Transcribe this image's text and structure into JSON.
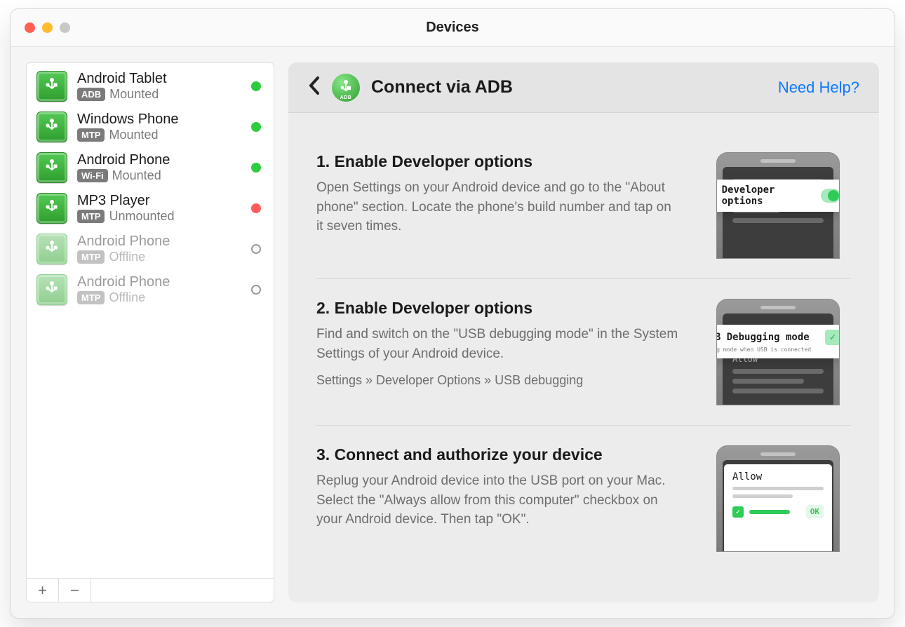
{
  "window": {
    "title": "Devices"
  },
  "sidebar": {
    "devices": [
      {
        "name": "Android Tablet",
        "protocol": "ADB",
        "status": "Mounted",
        "dot": "online",
        "faded": false
      },
      {
        "name": "Windows Phone",
        "protocol": "MTP",
        "status": "Mounted",
        "dot": "online",
        "faded": false
      },
      {
        "name": "Android Phone",
        "protocol": "Wi-Fi",
        "status": "Mounted",
        "dot": "online",
        "faded": false
      },
      {
        "name": "MP3 Player",
        "protocol": "MTP",
        "status": "Unmounted",
        "dot": "offline",
        "faded": false
      },
      {
        "name": "Android Phone",
        "protocol": "MTP",
        "status": "Offline",
        "dot": "hollow",
        "faded": true
      },
      {
        "name": "Android Phone",
        "protocol": "MTP",
        "status": "Offline",
        "dot": "hollow",
        "faded": true
      }
    ],
    "add_label": "+",
    "remove_label": "−"
  },
  "main": {
    "header": {
      "title": "Connect via ADB",
      "help": "Need Help?",
      "adb_label": "ADB"
    },
    "steps": [
      {
        "title": "1. Enable Developer options",
        "body": "Open Settings on your Android device and go to the \"About phone\" section. Locate the phone's build number and tap on it seven times.",
        "path": "",
        "mock": {
          "type": "dev-options",
          "label": "Developer options"
        }
      },
      {
        "title": "2. Enable Developer options",
        "body": "Find and switch on the \"USB debugging mode\" in the System Settings of your Android device.",
        "path": "Settings » Developer Options » USB debugging",
        "mock": {
          "type": "usb-debug",
          "label": "USB Debugging mode",
          "sub": "Debug mode when USB is connected",
          "allow": "Allow"
        }
      },
      {
        "title": "3. Connect and authorize your device",
        "body": "Replug your Android device into the USB port on your Mac. Select the \"Always allow from this computer\" checkbox on your Android device. Then tap \"OK\".",
        "path": "",
        "mock": {
          "type": "authorize",
          "label": "Allow",
          "ok": "OK"
        }
      }
    ]
  }
}
